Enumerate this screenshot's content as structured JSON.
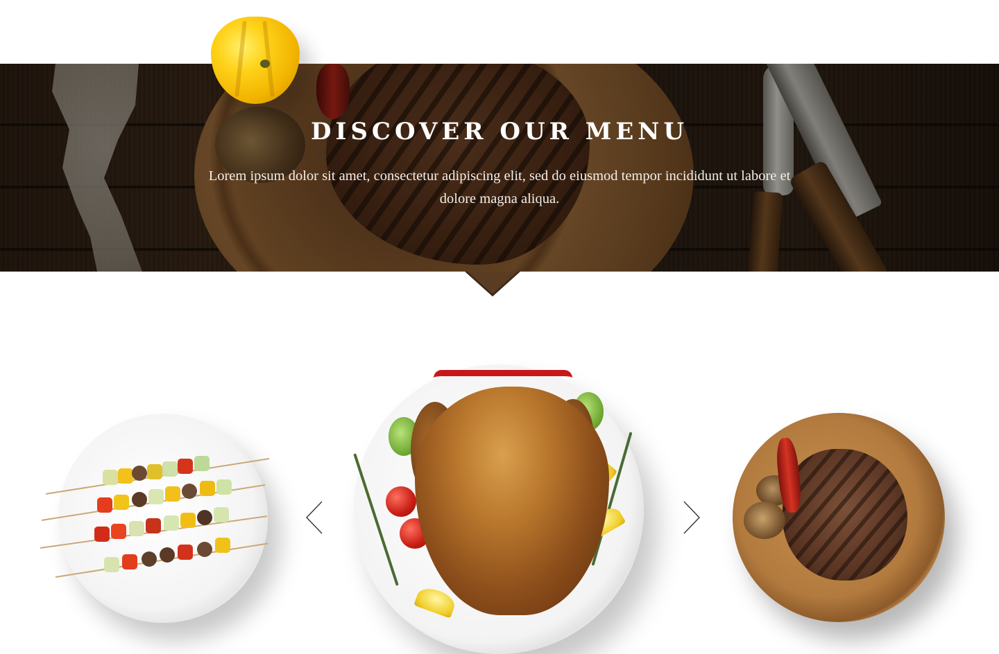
{
  "banner": {
    "title": "DISCOVER OUR MENU",
    "description": "Lorem ipsum dolor sit amet, consectetur adipiscing elit, sed do eiusmod tempor incididunt ut labore et dolore magna aliqua."
  },
  "carousel": {
    "prev_icon": "chevron-left-icon",
    "next_icon": "chevron-right-icon",
    "dishes": [
      {
        "image": "vegetable-skewers-plate"
      },
      {
        "image": "roast-chicken-plate"
      },
      {
        "image": "grilled-steak-board"
      }
    ]
  },
  "colors": {
    "banner_overlay": "#1a0f06",
    "text": "#ffffff",
    "arrow": "#333333"
  }
}
